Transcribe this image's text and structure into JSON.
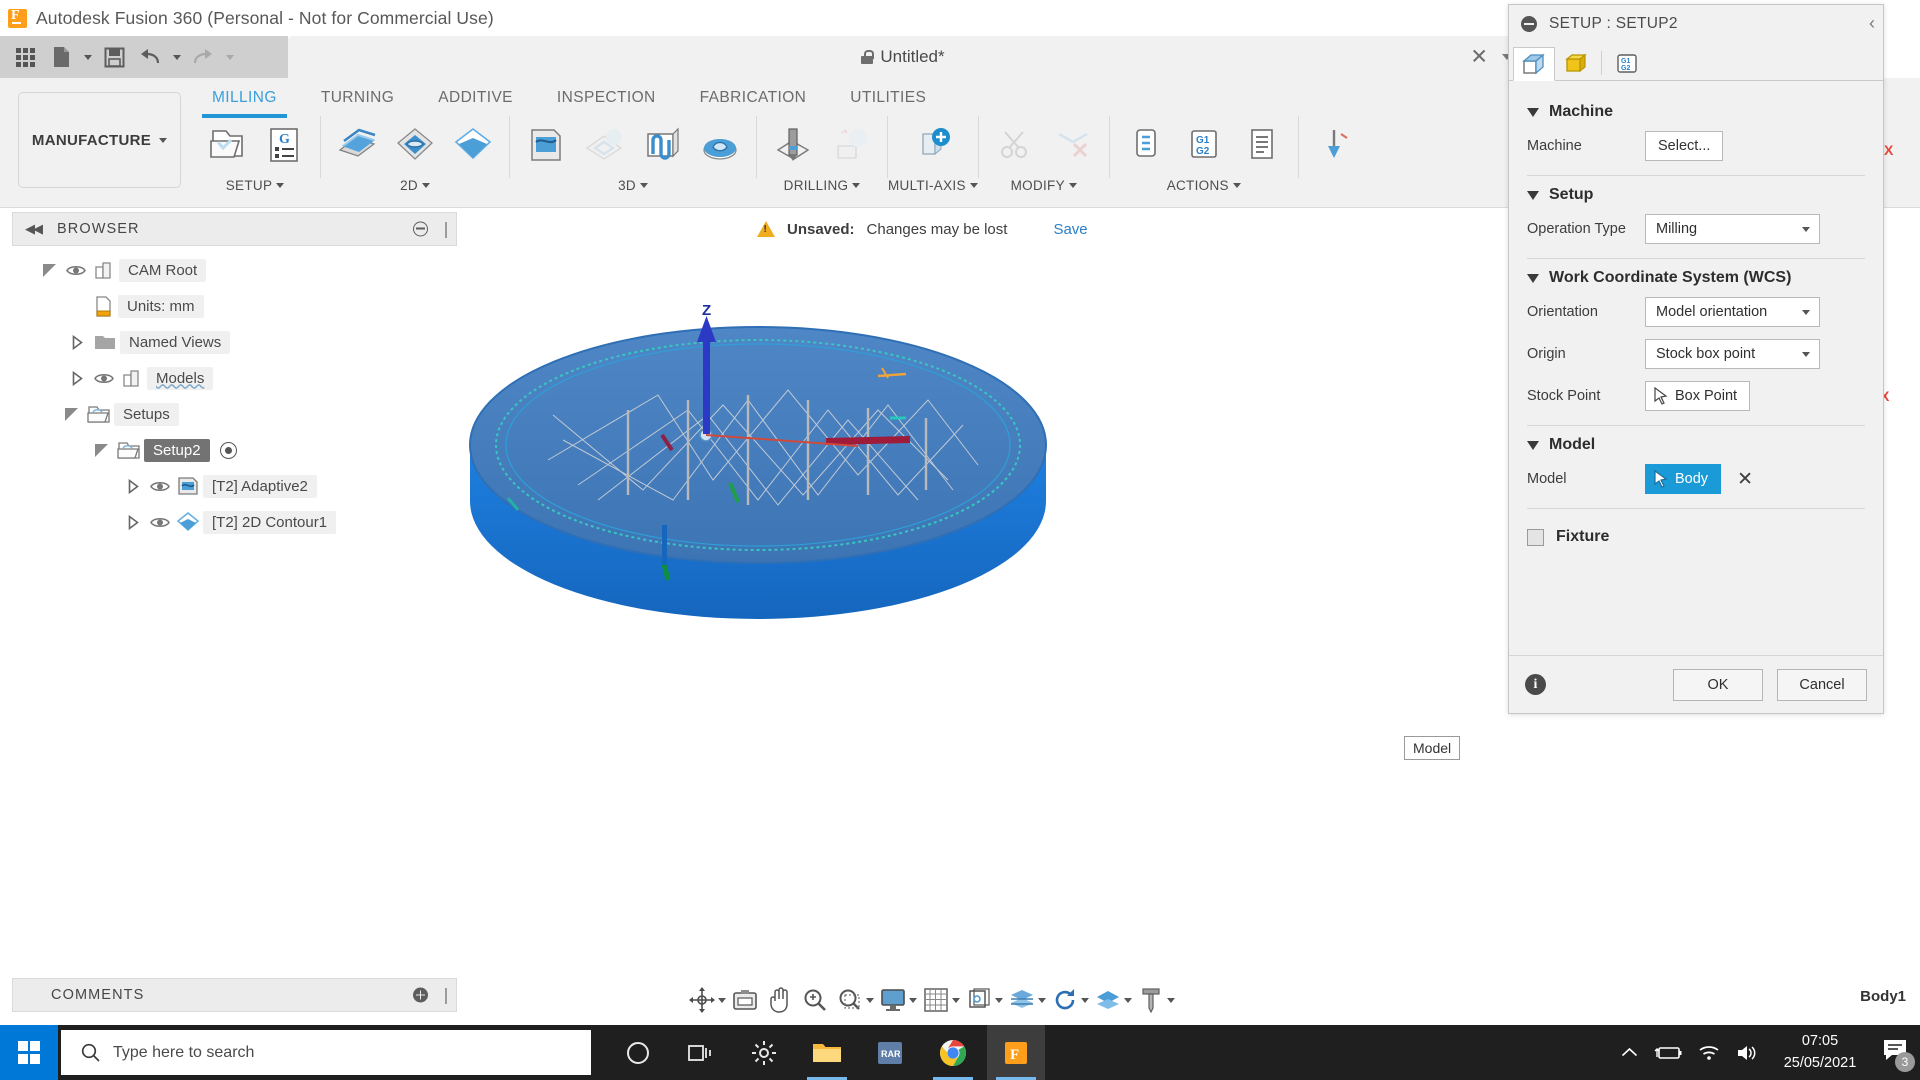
{
  "window": {
    "title": "Autodesk Fusion 360 (Personal - Not for Commercial Use)",
    "logo_icon": "fusion-logo-icon"
  },
  "quick_access": {
    "items": [
      {
        "name": "app-grid-button",
        "icon": "grid-icon"
      },
      {
        "name": "new-document-button",
        "icon": "document-icon",
        "has_caret": true
      },
      {
        "name": "save-button",
        "icon": "floppy-disk-icon"
      },
      {
        "name": "undo-button",
        "icon": "undo-arrow-icon",
        "has_caret": true
      },
      {
        "name": "redo-button",
        "icon": "redo-arrow-icon",
        "has_caret": true
      }
    ]
  },
  "document_tab": {
    "title": "Untitled*",
    "lock_icon": "lock-icon",
    "close_label": "✕"
  },
  "workspace": {
    "label": "MANUFACTURE"
  },
  "ribbon": {
    "tabs": [
      {
        "label": "MILLING",
        "active": true
      },
      {
        "label": "TURNING",
        "active": false
      },
      {
        "label": "ADDITIVE",
        "active": false
      },
      {
        "label": "INSPECTION",
        "active": false
      },
      {
        "label": "FABRICATION",
        "active": false
      },
      {
        "label": "UTILITIES",
        "active": false
      }
    ],
    "groups": [
      {
        "label": "SETUP",
        "has_caret": true,
        "commands": [
          {
            "name": "new-setup-button",
            "icon": "setup-folder-icon",
            "disabled": false
          },
          {
            "name": "post-process-button",
            "icon": "g-code-list-icon",
            "disabled": false
          }
        ]
      },
      {
        "label": "2D",
        "has_caret": true,
        "commands": [
          {
            "name": "face-button",
            "icon": "face-milling-icon",
            "disabled": false
          },
          {
            "name": "adaptive-clearing-button",
            "icon": "adaptive-clearing-icon",
            "disabled": false
          },
          {
            "name": "contour-2d-button",
            "icon": "contour-2d-icon",
            "disabled": false
          }
        ]
      },
      {
        "label": "3D",
        "has_caret": true,
        "commands": [
          {
            "name": "adaptive-3d-button",
            "icon": "adaptive-3d-icon",
            "disabled": false
          },
          {
            "name": "pocket-clearing-button",
            "icon": "pocket-clearing-icon",
            "disabled": true
          },
          {
            "name": "parallel-button",
            "icon": "parallel-passes-icon",
            "disabled": false
          },
          {
            "name": "scallop-button",
            "icon": "scallop-icon",
            "disabled": false
          }
        ]
      },
      {
        "label": "DRILLING",
        "has_caret": true,
        "commands": [
          {
            "name": "drill-button",
            "icon": "drill-bit-icon",
            "disabled": false
          },
          {
            "name": "bore-button",
            "icon": "bore-icon",
            "disabled": true
          }
        ]
      },
      {
        "label": "MULTI-AXIS",
        "has_caret": true,
        "commands": [
          {
            "name": "multi-axis-contour-button",
            "icon": "multi-axis-icon",
            "disabled": false
          }
        ]
      },
      {
        "label": "MODIFY",
        "has_caret": true,
        "commands": [
          {
            "name": "trim-button",
            "icon": "scissors-icon",
            "disabled": true
          },
          {
            "name": "delete-toolpath-button",
            "icon": "delete-toolpath-icon",
            "disabled": true
          }
        ]
      },
      {
        "label": "ACTIONS",
        "has_caret": true,
        "commands": [
          {
            "name": "simulate-button",
            "icon": "simulate-icon",
            "disabled": false
          },
          {
            "name": "post-process-action-button",
            "icon": "g1-g2-icon",
            "disabled": false
          },
          {
            "name": "setup-sheet-button",
            "icon": "setup-sheet-icon",
            "disabled": false
          }
        ]
      }
    ]
  },
  "browser": {
    "header": "BROWSER",
    "collapse_icon": "collapse-left-icon",
    "tree": [
      {
        "label": "CAM Root",
        "icon": "cam-root-icon",
        "twisty": "down",
        "eye": true,
        "indent": 0,
        "selected": false
      },
      {
        "label": "Units: mm",
        "icon": "units-doc-icon",
        "twisty": "none",
        "eye": false,
        "indent": 1,
        "selected": false
      },
      {
        "label": "Named Views",
        "icon": "folder-icon",
        "twisty": "right",
        "eye": false,
        "indent": 1,
        "selected": false
      },
      {
        "label": "Models",
        "icon": "models-icon",
        "twisty": "right",
        "eye": true,
        "indent": 1,
        "selected": false
      },
      {
        "label": "Setups",
        "icon": "setups-folder-icon",
        "twisty": "down",
        "eye": false,
        "indent": 1,
        "selected": false
      },
      {
        "label": "Setup2",
        "icon": "setup-folder-open-icon",
        "twisty": "down",
        "eye": false,
        "indent": 2,
        "selected": true,
        "radio": true
      },
      {
        "label": "[T2] Adaptive2",
        "icon": "adaptive-op-icon",
        "twisty": "right",
        "eye": true,
        "indent": 3,
        "selected": false
      },
      {
        "label": "[T2] 2D Contour1",
        "icon": "contour-op-icon",
        "twisty": "right",
        "eye": true,
        "indent": 3,
        "selected": false
      }
    ]
  },
  "unsaved_banner": {
    "warning_icon": "warning-triangle-icon",
    "label": "Unsaved:",
    "message": "Changes may be lost",
    "save_link": "Save"
  },
  "canvas": {
    "z_axis_label": "Z",
    "x_axis_label_top": "X",
    "x_axis_label_right": "X",
    "tooltip": "Model",
    "body_label": "Body1"
  },
  "dialog": {
    "title": "SETUP : SETUP2",
    "minimize_icon": "minimize-dot-icon",
    "chevron_icon": "chevron-left-icon",
    "tabs": [
      {
        "name": "setup-tab",
        "icon": "setup-cube-icon",
        "active": true
      },
      {
        "name": "stock-tab",
        "icon": "stock-box-icon",
        "active": false
      },
      {
        "name": "post-process-tab",
        "icon": "g1-g2-icon",
        "active": false
      }
    ],
    "sections": {
      "machine": {
        "title": "Machine",
        "machine_label": "Machine",
        "machine_button": "Select..."
      },
      "setup": {
        "title": "Setup",
        "operation_type_label": "Operation Type",
        "operation_type_value": "Milling"
      },
      "wcs": {
        "title": "Work Coordinate System (WCS)",
        "orientation_label": "Orientation",
        "orientation_value": "Model orientation",
        "origin_label": "Origin",
        "origin_value": "Stock box point",
        "stock_point_label": "Stock Point",
        "stock_point_value": "Box Point"
      },
      "model": {
        "title": "Model",
        "model_label": "Model",
        "model_value": "Body",
        "clear_icon": "x-clear-icon"
      },
      "fixture": {
        "title": "Fixture",
        "checked": false
      }
    },
    "footer": {
      "info_icon": "info-icon",
      "ok_label": "OK",
      "cancel_label": "Cancel"
    }
  },
  "comments": {
    "header": "COMMENTS",
    "add_icon": "add-comment-icon"
  },
  "navbar": {
    "items": [
      {
        "name": "orbit-button",
        "icon": "orbit-icon",
        "has_caret": true
      },
      {
        "name": "look-at-button",
        "icon": "look-at-icon",
        "has_caret": false
      },
      {
        "name": "pan-button",
        "icon": "pan-hand-icon",
        "has_caret": false
      },
      {
        "name": "zoom-button",
        "icon": "zoom-icon",
        "has_caret": false
      },
      {
        "name": "fit-button",
        "icon": "zoom-window-icon",
        "has_caret": true
      },
      {
        "name": "display-settings-button",
        "icon": "monitor-icon",
        "has_caret": true
      },
      {
        "name": "grid-snap-button",
        "icon": "grid-snap-icon",
        "has_caret": true
      },
      {
        "name": "viewports-button",
        "icon": "viewports-icon",
        "has_caret": true
      },
      {
        "name": "layers-button",
        "icon": "layers-stack-icon",
        "has_caret": true
      },
      {
        "name": "refresh-button",
        "icon": "refresh-icon",
        "has_caret": true
      },
      {
        "name": "visual-style-button",
        "icon": "visual-style-icon",
        "has_caret": true
      },
      {
        "name": "effects-button",
        "icon": "screw-icon",
        "has_caret": true
      }
    ]
  },
  "taskbar": {
    "start_icon": "windows-logo-icon",
    "search_placeholder": "Type here to search",
    "search_icon": "search-icon",
    "apps": [
      {
        "name": "cortana-button",
        "icon": "circle-icon",
        "active": false
      },
      {
        "name": "task-view-button",
        "icon": "task-view-icon",
        "active": false
      },
      {
        "name": "settings-button",
        "icon": "gear-icon",
        "active": false
      },
      {
        "name": "file-explorer-button",
        "icon": "folder-icon",
        "active": true
      },
      {
        "name": "winrar-button",
        "icon": "rar-icon",
        "active": false,
        "label": "RAR"
      },
      {
        "name": "chrome-button",
        "icon": "chrome-icon",
        "active": true
      },
      {
        "name": "fusion360-button",
        "icon": "fusion-logo-icon",
        "active": true
      }
    ],
    "tray": {
      "chevron_icon": "chevron-up-icon",
      "battery_icon": "battery-charging-icon",
      "wifi_icon": "wifi-icon",
      "volume_icon": "speaker-icon",
      "time": "07:05",
      "date": "25/05/2021",
      "notification_icon": "notification-icon",
      "notification_count": "3"
    }
  }
}
